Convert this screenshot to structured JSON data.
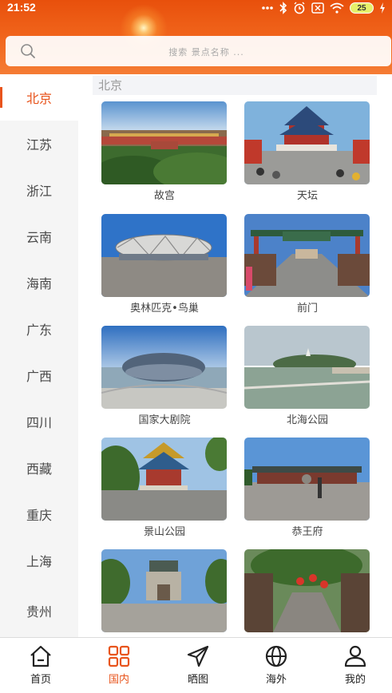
{
  "status_bar": {
    "time": "21:52",
    "battery": "25",
    "icons": [
      "dots-icon",
      "bluetooth-icon",
      "alarm-icon",
      "sim-icon",
      "wifi-icon",
      "battery-icon",
      "charging-icon"
    ]
  },
  "search": {
    "placeholder": "搜索 景点名称 ..."
  },
  "sidebar": {
    "items": [
      {
        "label": "北京",
        "active": true
      },
      {
        "label": "江苏"
      },
      {
        "label": "浙江"
      },
      {
        "label": "云南"
      },
      {
        "label": "海南"
      },
      {
        "label": "广东"
      },
      {
        "label": "广西"
      },
      {
        "label": "四川"
      },
      {
        "label": "西藏"
      },
      {
        "label": "重庆"
      },
      {
        "label": "上海"
      },
      {
        "label": "贵州"
      }
    ]
  },
  "content": {
    "city_title": "北京",
    "attractions": [
      {
        "name": "故宫"
      },
      {
        "name": "天坛"
      },
      {
        "name": "奥林匹克•鸟巢"
      },
      {
        "name": "前门"
      },
      {
        "name": "国家大剧院"
      },
      {
        "name": "北海公园"
      },
      {
        "name": "景山公园"
      },
      {
        "name": "恭王府"
      }
    ]
  },
  "bottom_nav": {
    "items": [
      {
        "label": "首页",
        "icon": "home-icon"
      },
      {
        "label": "国内",
        "icon": "grid-icon",
        "active": true
      },
      {
        "label": "晒图",
        "icon": "send-icon"
      },
      {
        "label": "海外",
        "icon": "globe-icon"
      },
      {
        "label": "我的",
        "icon": "person-icon"
      }
    ]
  },
  "colors": {
    "accent": "#e8541c",
    "header_top": "#e8500c",
    "header_bottom": "#f57c34"
  }
}
